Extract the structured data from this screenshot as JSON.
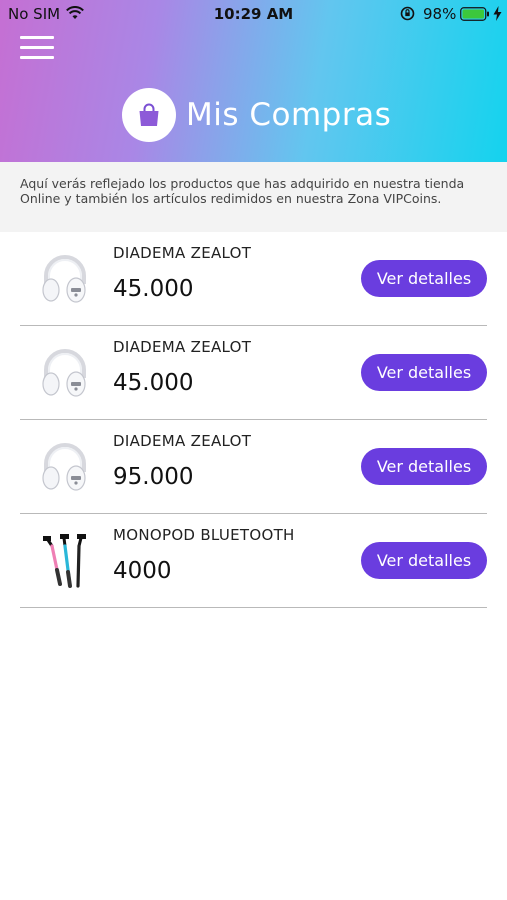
{
  "status_bar": {
    "carrier": "No SIM",
    "time": "10:29 AM",
    "battery": "98%"
  },
  "header": {
    "menu_icon": "hamburger-menu-icon",
    "title_icon": "shopping-bag-icon",
    "title": "Mis Compras"
  },
  "intro": {
    "text": "Aquí verás reflejado los productos que has adquirido en nuestra tienda Online y también los artículos redimidos en nuestra Zona VIPCoins."
  },
  "purchases": [
    {
      "name": "DIADEMA ZEALOT",
      "price": "45.000",
      "image": "headphones-image",
      "button": "Ver detalles"
    },
    {
      "name": "DIADEMA ZEALOT",
      "price": "45.000",
      "image": "headphones-image",
      "button": "Ver detalles"
    },
    {
      "name": "DIADEMA ZEALOT",
      "price": "95.000",
      "image": "headphones-image",
      "button": "Ver detalles"
    },
    {
      "name": "MONOPOD BLUETOOTH",
      "price": "4000",
      "image": "selfie-sticks-image",
      "button": "Ver detalles"
    }
  ],
  "colors": {
    "accent": "#6a3ddf",
    "gradient_start": "#c56fd3",
    "gradient_end": "#14d3ee"
  }
}
